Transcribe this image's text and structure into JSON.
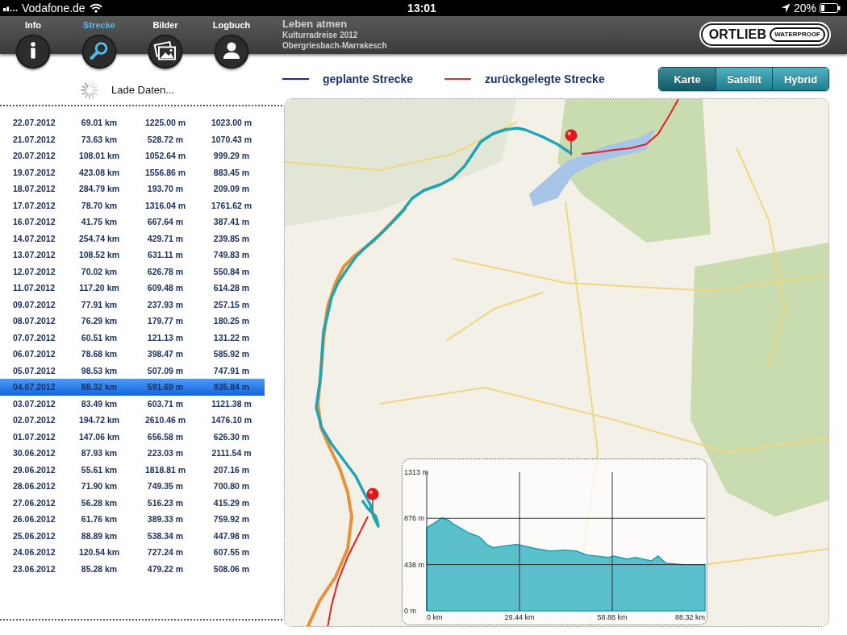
{
  "status_bar": {
    "carrier": "Vodafone.de",
    "time": "13:01",
    "battery": "20%"
  },
  "tabs": [
    {
      "label": "Info",
      "kind": "info",
      "selected": false
    },
    {
      "label": "Strecke",
      "kind": "search",
      "selected": true
    },
    {
      "label": "Bilder",
      "kind": "pictures",
      "selected": false
    },
    {
      "label": "Logbuch",
      "kind": "person",
      "selected": false
    }
  ],
  "header": {
    "title": "Leben atmen",
    "lines": [
      "Kulturradreise 2012",
      "Obergriesbach-Marrakesch"
    ]
  },
  "logo": {
    "name": "ORTLIEB",
    "badge": "WATERPROOF"
  },
  "loading": {
    "label": "Lade Daten..."
  },
  "table": {
    "rows": [
      {
        "cells": [
          "22.07.2012",
          "69.01 km",
          "1225.00 m",
          "1023.00 m"
        ],
        "selected": false
      },
      {
        "cells": [
          "21.07.2012",
          "73.63 km",
          "528.72 m",
          "1070.43 m"
        ],
        "selected": false
      },
      {
        "cells": [
          "20.07.2012",
          "108.01 km",
          "1052.64 m",
          "999.29 m"
        ],
        "selected": false
      },
      {
        "cells": [
          "19.07.2012",
          "423.08 km",
          "1556.86 m",
          "883.45 m"
        ],
        "selected": false
      },
      {
        "cells": [
          "18.07.2012",
          "284.79 km",
          "193.70 m",
          "209.09 m"
        ],
        "selected": false
      },
      {
        "cells": [
          "17.07.2012",
          "78.70 km",
          "1316.04 m",
          "1761.62 m"
        ],
        "selected": false
      },
      {
        "cells": [
          "16.07.2012",
          "41.75 km",
          "667.64 m",
          "387.41 m"
        ],
        "selected": false
      },
      {
        "cells": [
          "14.07.2012",
          "254.74 km",
          "429.71 m",
          "239.85 m"
        ],
        "selected": false
      },
      {
        "cells": [
          "13.07.2012",
          "108.52 km",
          "631.11 m",
          "749.83 m"
        ],
        "selected": false
      },
      {
        "cells": [
          "12.07.2012",
          "70.02 km",
          "626.78 m",
          "550.84 m"
        ],
        "selected": false
      },
      {
        "cells": [
          "11.07.2012",
          "117.20 km",
          "609.48 m",
          "614.28 m"
        ],
        "selected": false
      },
      {
        "cells": [
          "09.07.2012",
          "77.91 km",
          "237.93 m",
          "257.15 m"
        ],
        "selected": false
      },
      {
        "cells": [
          "08.07.2012",
          "76.29 km",
          "179.77 m",
          "180.25 m"
        ],
        "selected": false
      },
      {
        "cells": [
          "07.07.2012",
          "60.51 km",
          "121.13 m",
          "131.22 m"
        ],
        "selected": false
      },
      {
        "cells": [
          "06.07.2012",
          "78.68 km",
          "398.47 m",
          "585.92 m"
        ],
        "selected": false
      },
      {
        "cells": [
          "05.07.2012",
          "98.53 km",
          "507.09 m",
          "747.91 m"
        ],
        "selected": false
      },
      {
        "cells": [
          "04.07.2012",
          "88.32 km",
          "591.69 m",
          "935.84 m"
        ],
        "selected": true
      },
      {
        "cells": [
          "03.07.2012",
          "83.49 km",
          "603.71 m",
          "1121.38 m"
        ],
        "selected": false
      },
      {
        "cells": [
          "02.07.2012",
          "194.72 km",
          "2610.46 m",
          "1476.10 m"
        ],
        "selected": false
      },
      {
        "cells": [
          "01.07.2012",
          "147.06 km",
          "656.58 m",
          "626.30 m"
        ],
        "selected": false
      },
      {
        "cells": [
          "30.06.2012",
          "87.93 km",
          "223.03 m",
          "2111.54 m"
        ],
        "selected": false
      },
      {
        "cells": [
          "29.06.2012",
          "55.61 km",
          "1818.81 m",
          "207.16 m"
        ],
        "selected": false
      },
      {
        "cells": [
          "28.06.2012",
          "71.90 km",
          "749.35 m",
          "700.80 m"
        ],
        "selected": false
      },
      {
        "cells": [
          "27.06.2012",
          "56.28 km",
          "516.23 m",
          "415.29 m"
        ],
        "selected": false
      },
      {
        "cells": [
          "26.06.2012",
          "61.76 km",
          "389.33 m",
          "759.92 m"
        ],
        "selected": false
      },
      {
        "cells": [
          "25.06.2012",
          "88.89 km",
          "538.34 m",
          "447.98 m"
        ],
        "selected": false
      },
      {
        "cells": [
          "24.06.2012",
          "120.54 km",
          "727.24 m",
          "607.55 m"
        ],
        "selected": false
      },
      {
        "cells": [
          "23.06.2012",
          "85.28 km",
          "479.22 m",
          "508.06 m"
        ],
        "selected": false
      }
    ]
  },
  "legend": [
    {
      "label": "geplante Strecke",
      "color": "#1a1aff"
    },
    {
      "label": "zurückgelegte Strecke",
      "color": "#ff2222"
    }
  ],
  "map_type": [
    {
      "label": "Karte",
      "selected": true
    },
    {
      "label": "Satellit",
      "selected": false
    },
    {
      "label": "Hybrid",
      "selected": false
    }
  ],
  "elevation_profile": {
    "chart_data": {
      "type": "area",
      "grid": true,
      "xlim": [
        0,
        88.32
      ],
      "ylim": [
        0,
        1313
      ],
      "x": [
        0,
        1.87,
        4.85,
        6.98,
        8.26,
        13.37,
        16.78,
        19.33,
        21.04,
        28.7,
        33.81,
        38.92,
        44.03,
        47.44,
        50.85,
        57.66,
        59.36,
        63.62,
        66.18,
        71.29,
        73.42,
        75.97,
        81.51,
        88.32
      ],
      "series": [
        {
          "color": "#5cbfcc",
          "values": [
            787,
            821,
            880,
            857,
            826,
            738,
            700,
            622,
            600,
            629,
            593,
            567,
            575,
            567,
            528,
            505,
            520,
            490,
            505,
            474,
            520,
            450,
            437,
            437
          ]
        }
      ],
      "xticks": [
        {
          "value": 0,
          "label": "0 km"
        },
        {
          "value": 29.44,
          "label": "29.44 km"
        },
        {
          "value": 58.88,
          "label": "58.88 km"
        },
        {
          "value": 88.32,
          "label": "88.32 km"
        }
      ],
      "yticks": [
        {
          "value": 0,
          "label": "0 m"
        },
        {
          "value": 438,
          "label": "438 m"
        },
        {
          "value": 876,
          "label": "876 m"
        },
        {
          "value": 1313,
          "label": "1313 m"
        }
      ]
    }
  }
}
